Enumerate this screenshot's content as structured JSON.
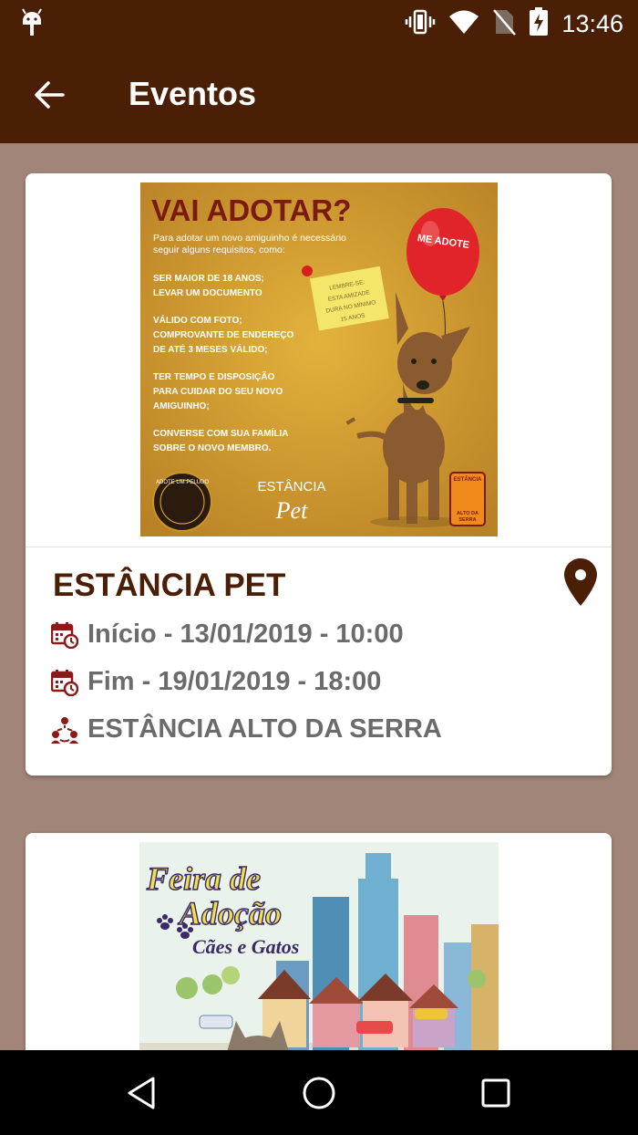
{
  "status_bar": {
    "time": "13:46",
    "icons": [
      "android-icon",
      "vibrate-icon",
      "wifi-icon",
      "no-sim-icon",
      "battery-charging-icon"
    ]
  },
  "app_bar": {
    "title": "Eventos",
    "back_icon": "arrow-back-icon"
  },
  "events": [
    {
      "poster": {
        "headline": "VAI ADOTAR?",
        "intro": "Para adotar um novo amiguinho é necessário seguir alguns requisitos, como:",
        "requirements": [
          "SER MAIOR DE 18 ANOS;",
          "LEVAR UM DOCUMENTO",
          "VÁLIDO COM FOTO;",
          "COMPROVANTE DE ENDEREÇO",
          "DE ATÉ 3 MESES VÁLIDO;",
          "TER TEMPO E DISPOSIÇÃO",
          "PARA CUIDAR DO SEU NOVO",
          "AMIGUINHO;",
          "CONVERSE COM SUA FAMÍLIA",
          "SOBRE O NOVO MEMBRO."
        ],
        "balloon": "ME ADOTE",
        "note": "LEMBRE-SE: ESTA AMIZADE DURA NO MÍNIMO 15 ANOS",
        "logo_left": "ADOTE UM PELUDO",
        "logo_center_top": "ESTÂNCIA",
        "logo_center_bottom": "Pet",
        "logo_right_top": "ESTÂNCIA",
        "logo_right_bottom": "ALTO DA SERRA"
      },
      "title": "ESTÂNCIA PET",
      "start": "Início - 13/01/2019 - 10:00",
      "end": "Fim - 19/01/2019 - 18:00",
      "location": "ESTÂNCIA ALTO DA SERRA",
      "colors": {
        "title": "#4a1f06",
        "icon": "#8b1a1a"
      }
    },
    {
      "poster": {
        "line1": "Feira de",
        "line2": "Adoção",
        "line3": "Cães e Gatos"
      }
    }
  ],
  "nav_bar": {
    "buttons": [
      "back-triangle-icon",
      "home-circle-icon",
      "recents-square-icon"
    ]
  },
  "colors": {
    "app_bar": "#4a1f06",
    "background": "#a08578",
    "poster_bg": "#c9962a"
  }
}
